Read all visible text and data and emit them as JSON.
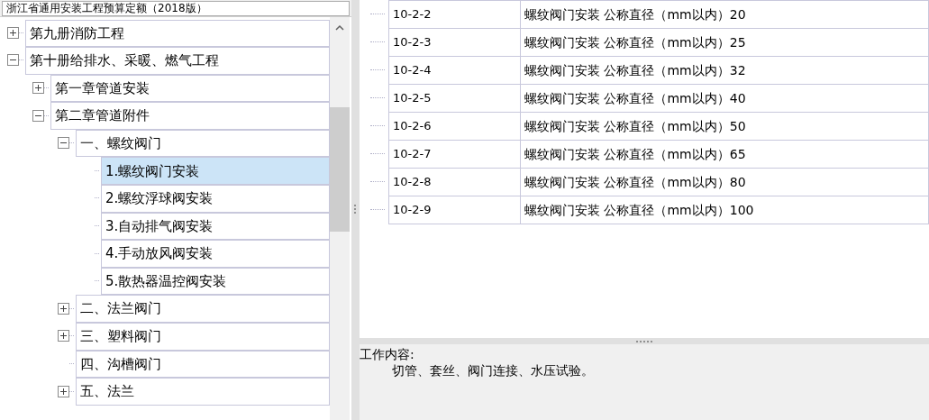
{
  "catalog_select": {
    "value": "浙江省通用安装工程预算定额（2018版）"
  },
  "tree": [
    {
      "label": "第九册消防工程",
      "expanded": false,
      "selected": false
    },
    {
      "label": "第十册给排水、采暖、燃气工程",
      "expanded": true,
      "selected": false,
      "children": [
        {
          "label": "第一章管道安装",
          "expanded": false,
          "selected": false
        },
        {
          "label": "第二章管道附件",
          "expanded": true,
          "selected": false,
          "children": [
            {
              "label": "一、螺纹阀门",
              "expanded": true,
              "selected": false,
              "children": [
                {
                  "label": "1.螺纹阀门安装",
                  "selected": true
                },
                {
                  "label": "2.螺纹浮球阀安装",
                  "selected": false
                },
                {
                  "label": "3.自动排气阀安装",
                  "selected": false
                },
                {
                  "label": "4.手动放风阀安装",
                  "selected": false
                },
                {
                  "label": "5.散热器温控阀安装",
                  "selected": false
                }
              ]
            },
            {
              "label": "二、法兰阀门",
              "expanded": false,
              "selected": false
            },
            {
              "label": "三、塑料阀门",
              "expanded": false,
              "selected": false
            },
            {
              "label": "四、沟槽阀门",
              "selected": false
            },
            {
              "label": "五、法兰",
              "expanded": false,
              "selected": false
            }
          ]
        }
      ]
    }
  ],
  "table": {
    "rows": [
      {
        "code": "10-2-2",
        "name": "螺纹阀门安装 公称直径（mm以内）20"
      },
      {
        "code": "10-2-3",
        "name": "螺纹阀门安装 公称直径（mm以内）25"
      },
      {
        "code": "10-2-4",
        "name": "螺纹阀门安装 公称直径（mm以内）32"
      },
      {
        "code": "10-2-5",
        "name": "螺纹阀门安装 公称直径（mm以内）40"
      },
      {
        "code": "10-2-6",
        "name": "螺纹阀门安装 公称直径（mm以内）50"
      },
      {
        "code": "10-2-7",
        "name": "螺纹阀门安装 公称直径（mm以内）65"
      },
      {
        "code": "10-2-8",
        "name": "螺纹阀门安装 公称直径（mm以内）80"
      },
      {
        "code": "10-2-9",
        "name": "螺纹阀门安装 公称直径（mm以内）100"
      }
    ]
  },
  "work_content": {
    "heading": "工作内容:",
    "text": "切管、套丝、阀门连接、水压试验。"
  }
}
